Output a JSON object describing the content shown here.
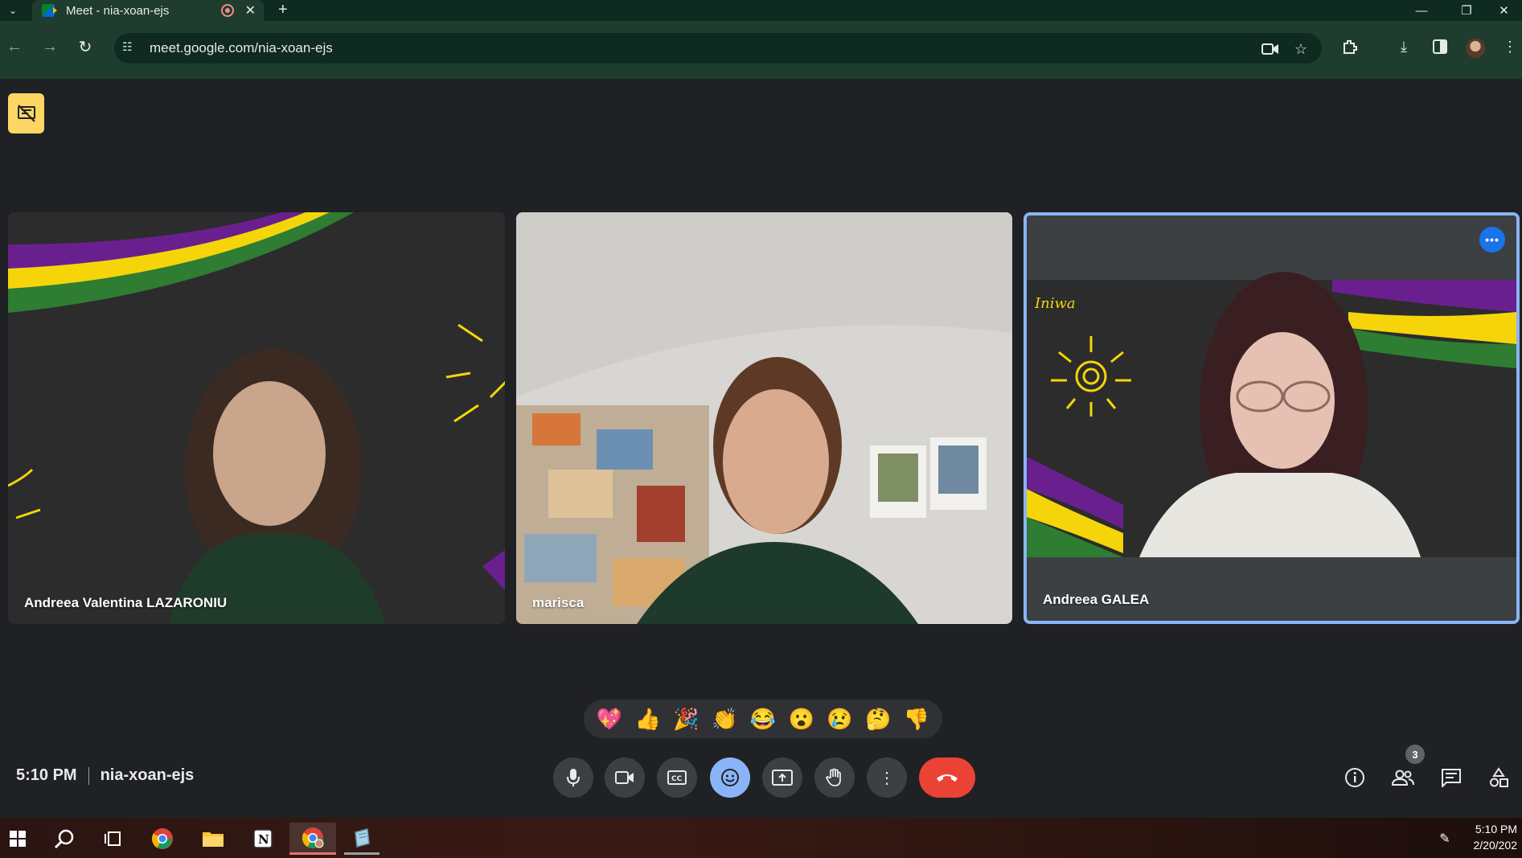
{
  "browser": {
    "tab_title": "Meet - nia-xoan-ejs",
    "url": "meet.google.com/nia-xoan-ejs",
    "new_tab": "+"
  },
  "meeting": {
    "time": "5:10 PM",
    "code": "nia-xoan-ejs",
    "participant_count": "3"
  },
  "participants": [
    {
      "name": "Andreea Valentina LAZARONIU"
    },
    {
      "name": "marisca"
    },
    {
      "name": "Andreea GALEA"
    }
  ],
  "reactions": [
    "💖",
    "👍",
    "🎉",
    "👏",
    "😂",
    "😮",
    "😢",
    "🤔",
    "👎"
  ],
  "taskbar": {
    "time": "5:10 PM",
    "date": "2/20/202"
  },
  "colors": {
    "accent": "#8ab4f8",
    "hangup": "#ea4335",
    "presenter_badge": "#fdd663",
    "background": "#202124"
  }
}
